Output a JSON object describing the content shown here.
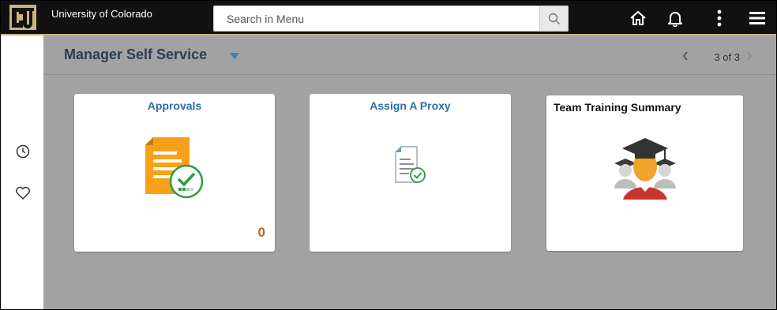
{
  "header": {
    "org_name": "University of Colorado",
    "search_placeholder": "Search in Menu",
    "icons": [
      "search-icon",
      "home-icon",
      "bell-icon",
      "more-vertical-icon",
      "hamburger-menu-icon"
    ],
    "background": "#111111",
    "accent": "#c8b47c"
  },
  "left_rail": {
    "icons": [
      "recent-clock-icon",
      "favorites-heart-icon"
    ]
  },
  "page": {
    "title": "Manager Self Service",
    "pager": "3 of 3"
  },
  "tiles": [
    {
      "title": "Approvals",
      "count": "0",
      "icon": "approvals-document-icon"
    },
    {
      "title": "Assign A Proxy",
      "icon": "assign-proxy-document-icon"
    },
    {
      "title": "Team Training Summary",
      "icon": "graduation-team-icon"
    }
  ],
  "colors": {
    "content_bg": "#a2a2a2",
    "tile_title": "#2e6ca6",
    "count": "#b6651c"
  }
}
